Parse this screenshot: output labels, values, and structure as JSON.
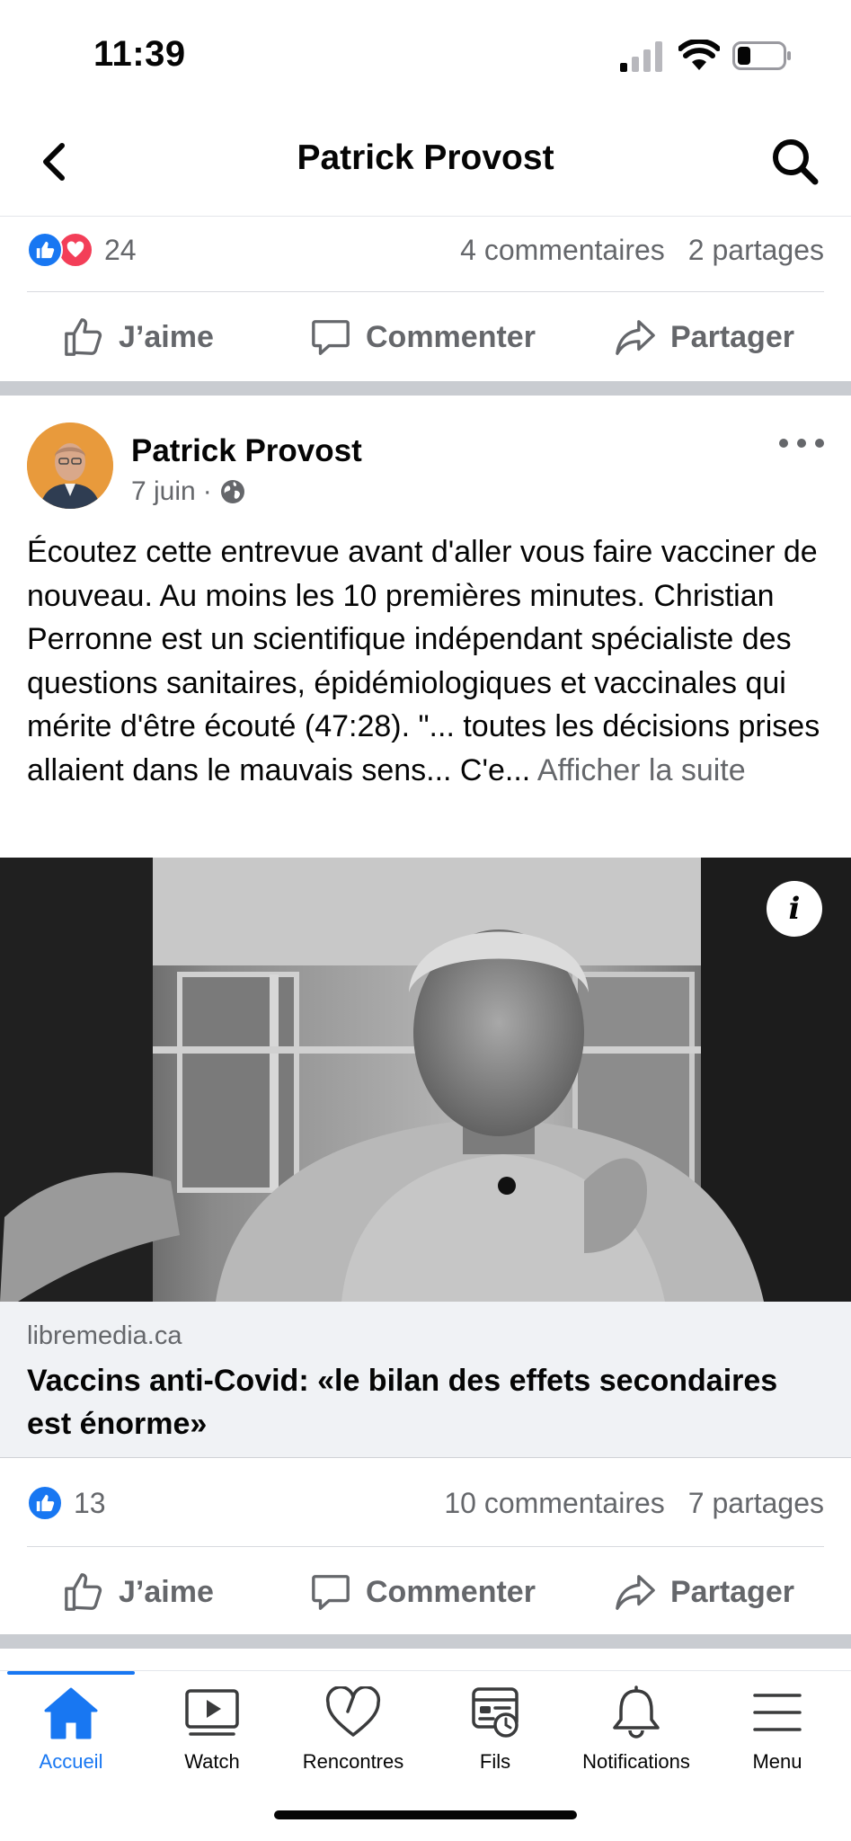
{
  "status_bar": {
    "time": "11:39"
  },
  "nav": {
    "title": "Patrick Provost"
  },
  "prev_post": {
    "reaction_count": "24",
    "comments": "4 commentaires",
    "shares": "2 partages"
  },
  "actions": {
    "like": "J’aime",
    "comment": "Commenter",
    "share": "Partager"
  },
  "post": {
    "author": "Patrick Provost",
    "date": "7 juin",
    "separator": "·",
    "visibility_icon": "globe-icon",
    "text": "Écoutez cette entrevue avant d'aller vous faire vacciner de nouveau. Au moins les 10 premières minutes. Christian Perronne est un scientifique indépendant spécialiste des questions sanitaires, épidémiologiques et vaccinales qui mérite d'être écouté (47:28). \"... toutes les décisions prises allaient dans le mauvais sens... C'e...",
    "see_more": "Afficher la suite",
    "link": {
      "domain": "libremedia.ca",
      "title": "Vaccins anti-Covid: «le bilan des effets secondaires est énorme»",
      "info_label": "i"
    },
    "reaction_count": "13",
    "comments": "10 commentaires",
    "shares": "7 partages"
  },
  "tabs": [
    {
      "label": "Accueil",
      "icon": "home-icon",
      "active": true
    },
    {
      "label": "Watch",
      "icon": "watch-icon",
      "active": false
    },
    {
      "label": "Rencontres",
      "icon": "heart-icon",
      "active": false
    },
    {
      "label": "Fils",
      "icon": "feeds-icon",
      "active": false
    },
    {
      "label": "Notifications",
      "icon": "bell-icon",
      "active": false
    },
    {
      "label": "Menu",
      "icon": "menu-icon",
      "active": false
    }
  ],
  "colors": {
    "accent": "#1877f2",
    "love": "#f33e58",
    "secondary_text": "#65676b",
    "separator": "#c9ccd1"
  }
}
